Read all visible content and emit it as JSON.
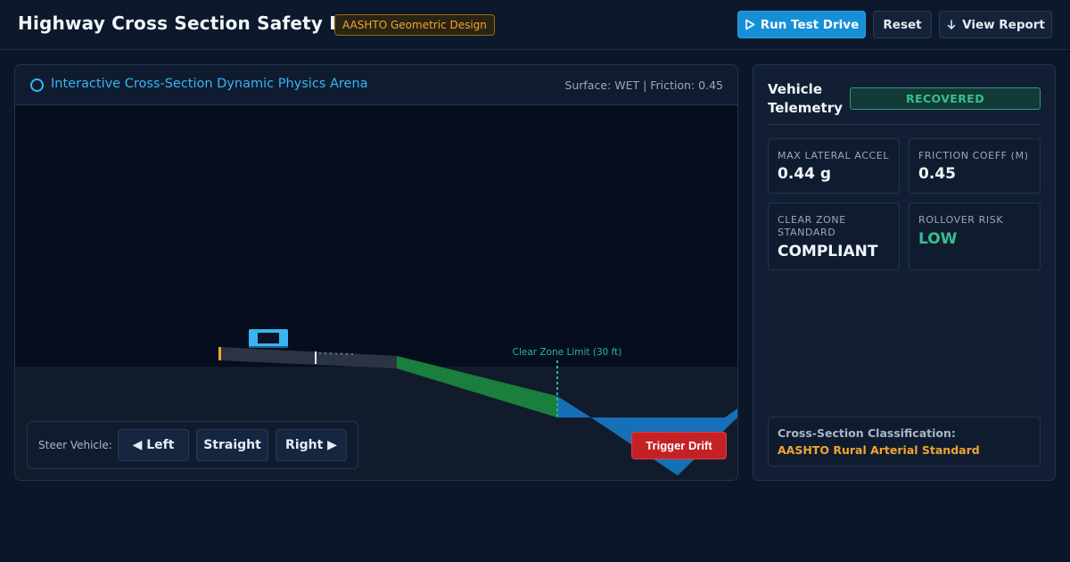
{
  "header": {
    "title": "Highway Cross Section Safety Lab",
    "badge": "AASHTO Geometric Design",
    "run_label": "Run Test Drive",
    "reset_label": "Reset",
    "report_label": "View Report"
  },
  "arena": {
    "title": "Interactive Cross-Section Dynamic Physics Arena",
    "status": "Surface: WET | Friction: 0.45",
    "clear_zone_label": "Clear Zone Limit (30 ft)",
    "steer_label": "Steer Vehicle:",
    "steer_left": "◀ Left",
    "steer_straight": "Straight",
    "steer_right": "Right ▶",
    "trigger_label": "Trigger Drift"
  },
  "telemetry": {
    "title": "Vehicle Telemetry",
    "status": "RECOVERED",
    "metrics": [
      {
        "label": "MAX LATERAL ACCEL",
        "value": "0.44 g"
      },
      {
        "label": "FRICTION COEFF (M)",
        "value": "0.45"
      },
      {
        "label": "CLEAR ZONE STANDARD",
        "value": "COMPLIANT"
      },
      {
        "label": "ROLLOVER RISK",
        "value": "LOW"
      }
    ],
    "classification_label": "Cross-Section Classification:",
    "classification_value": "AASHTO Rural Arterial Standard"
  },
  "colors": {
    "accent": "#168fd6",
    "success": "#36c08c",
    "warning": "#f0a531",
    "danger": "#c42127",
    "slope": "#1a7f3c",
    "ditch": "#1670b8",
    "vehicle": "#3ab4f2"
  }
}
